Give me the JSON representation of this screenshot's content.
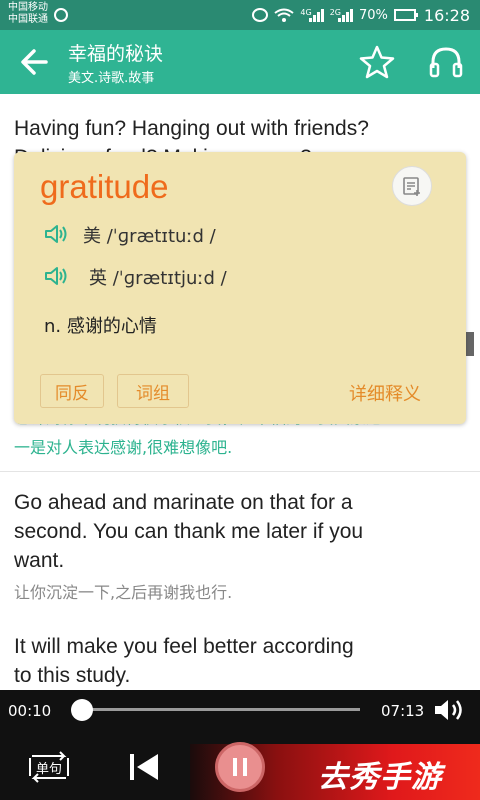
{
  "status_bar": {
    "carrier_1": "中国移动",
    "carrier_2": "中国联通",
    "network_1": "4G",
    "network_2": "2G",
    "battery": "70%",
    "battery_level": 0.7,
    "time": "16:28"
  },
  "header": {
    "title": "幸福的秘诀",
    "subtitle": "美文.诗歌.故事",
    "icons": [
      "back-arrow-icon",
      "star-icon",
      "headphone-icon"
    ]
  },
  "article": {
    "p1_line1": "Having fun? Hanging out with friends?",
    "p1_line2_partial": "Delicious food? Making money?",
    "p1_zh_line1": "也许对你来说获得快乐很重要，但幸福的主要因素之",
    "p1_zh_line2": "一是对人表达感谢,很难想像吧.",
    "p2_line1": "Go ahead and marinate on that for a",
    "p2_line2": "second. You can thank me later if you",
    "p2_line3": "want.",
    "p2_zh": "让你沉淀一下,之后再谢我也行.",
    "p3_line1": "It will make you feel better according",
    "p3_line2": "to this study."
  },
  "dictionary": {
    "word": "gratitude",
    "us_label": "美",
    "us_phonetic": "/ˈɡrætɪtuːd /",
    "uk_label": "英",
    "uk_phonetic": "/ˈɡrætɪtjuːd /",
    "definition": "n. 感谢的心情",
    "synonyms_button": "同反",
    "phrases_button": "词组",
    "details_link": "详细释义"
  },
  "player": {
    "current_time": "00:10",
    "total_time": "07:13",
    "progress": 0.02,
    "mode_label": "单句"
  },
  "watermark": "去秀手游",
  "colors": {
    "header": "#2fb493",
    "status_bar": "#2a8a72",
    "accent_green": "#2db38f",
    "word_orange": "#ef6b1c",
    "popup_bg": "#f1e4b2"
  }
}
